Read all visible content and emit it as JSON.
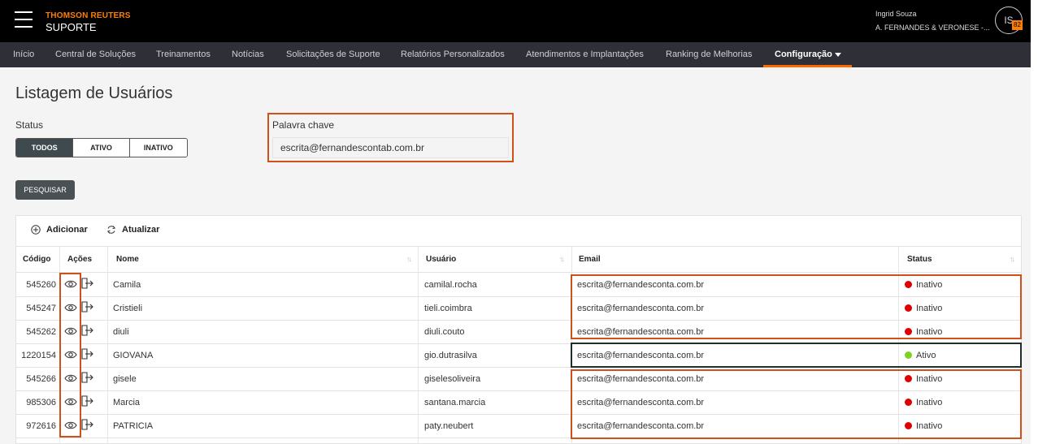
{
  "header": {
    "brand_top": "THOMSON REUTERS",
    "brand_bottom": "SUPORTE",
    "user_name": "Ingrid Souza",
    "user_company": "A. FERNANDES & VERONESE -...",
    "avatar_initials": "IS",
    "badge_count": "82"
  },
  "nav": {
    "items": [
      "Início",
      "Central de Soluções",
      "Treinamentos",
      "Notícias",
      "Solicitações de Suporte",
      "Relatórios Personalizados",
      "Atendimentos e Implantações",
      "Ranking de Melhorias",
      "Configuração"
    ],
    "active": "Configuração"
  },
  "page": {
    "title": "Listagem de Usuários",
    "status_label": "Status",
    "status_options": [
      "TODOS",
      "ATIVO",
      "INATIVO"
    ],
    "status_selected": "TODOS",
    "keyword_label": "Palavra chave",
    "keyword_value": "escrita@fernandescontab.com.br",
    "search_button": "PESQUISAR"
  },
  "grid": {
    "toolbar": {
      "add": "Adicionar",
      "refresh": "Atualizar"
    },
    "columns": [
      "Código",
      "Ações",
      "Nome",
      "Usuário",
      "Email",
      "Status"
    ],
    "rows": [
      {
        "codigo": "545260",
        "nome": "Camila",
        "usuario": "camilal.rocha",
        "email": "escrita@fernandesconta.com.br",
        "status": "Inativo"
      },
      {
        "codigo": "545247",
        "nome": "Cristieli",
        "usuario": "tieli.coimbra",
        "email": "escrita@fernandesconta.com.br",
        "status": "Inativo"
      },
      {
        "codigo": "545262",
        "nome": "diuli",
        "usuario": "diuli.couto",
        "email": "escrita@fernandesconta.com.br",
        "status": "Inativo"
      },
      {
        "codigo": "1220154",
        "nome": "GIOVANA",
        "usuario": "gio.dutrasilva",
        "email": "escrita@fernandesconta.com.br",
        "status": "Ativo"
      },
      {
        "codigo": "545266",
        "nome": "gisele",
        "usuario": "giselesoliveira",
        "email": "escrita@fernandesconta.com.br",
        "status": "Inativo"
      },
      {
        "codigo": "985306",
        "nome": "Marcia",
        "usuario": "santana.marcia",
        "email": "escrita@fernandesconta.com.br",
        "status": "Inativo"
      },
      {
        "codigo": "972616",
        "nome": "PATRICIA",
        "usuario": "paty.neubert",
        "email": "escrita@fernandesconta.com.br",
        "status": "Inativo"
      }
    ]
  },
  "colors": {
    "accent": "#ff6a00",
    "highlight": "#d0501a",
    "inactive": "#e00000",
    "active": "#7ed321"
  }
}
